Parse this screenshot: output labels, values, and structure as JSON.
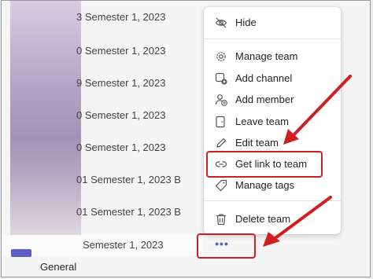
{
  "teams": [
    {
      "name": "3 Semester 1, 2023"
    },
    {
      "name": "0 Semester 1, 2023"
    },
    {
      "name": "9 Semester 1, 2023"
    },
    {
      "name": "0 Semester 1, 2023"
    },
    {
      "name": "0 Semester 1, 2023"
    },
    {
      "name": "01 Semester 1, 2023 B"
    },
    {
      "name": "01 Semester 1, 2023 B"
    },
    {
      "name": "Semester 1, 2023"
    }
  ],
  "channel": {
    "name": "General"
  },
  "more_button": {
    "glyph": "•••"
  },
  "menu": {
    "items": [
      {
        "label": "Hide",
        "icon": "eye-slash-icon"
      },
      {
        "label": "Manage team",
        "icon": "gear-icon"
      },
      {
        "label": "Add channel",
        "icon": "add-channel-icon"
      },
      {
        "label": "Add member",
        "icon": "add-member-icon"
      },
      {
        "label": "Leave team",
        "icon": "leave-icon"
      },
      {
        "label": "Edit team",
        "icon": "pencil-icon"
      },
      {
        "label": "Get link to team",
        "icon": "link-icon"
      },
      {
        "label": "Manage tags",
        "icon": "tag-icon"
      },
      {
        "label": "Delete team",
        "icon": "trash-icon"
      }
    ]
  },
  "colors": {
    "accent": "#5b5fc7",
    "annotation": "#cf1f1f"
  }
}
